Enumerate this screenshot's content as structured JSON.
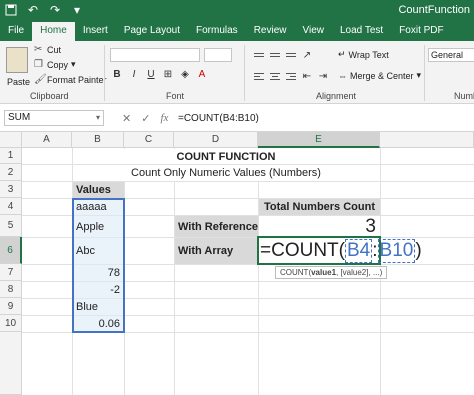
{
  "title_bar": {
    "doc_title": "CountFunction"
  },
  "tabs": [
    "File",
    "Home",
    "Insert",
    "Page Layout",
    "Formulas",
    "Review",
    "View",
    "Load Test",
    "Foxit PDF"
  ],
  "active_tab": "Home",
  "ribbon": {
    "paste": "Paste",
    "cut": "Cut",
    "copy": "Copy",
    "format_painter": "Format Painter",
    "clipboard": "Clipboard",
    "font": "Font",
    "wrap_text": "Wrap Text",
    "merge_center": "Merge & Center",
    "alignment": "Alignment",
    "number_format": "General",
    "number_group": "Numb"
  },
  "formula_bar": {
    "name_box": "SUM",
    "formula": "=COUNT(B4:B10)"
  },
  "columns": [
    "A",
    "B",
    "C",
    "D",
    "E"
  ],
  "rows": [
    "1",
    "2",
    "3",
    "4",
    "5",
    "6",
    "7",
    "8",
    "9",
    "10"
  ],
  "sheet": {
    "title": "COUNT FUNCTION",
    "subtitle": "Count Only Numeric Values (Numbers)",
    "values_header": "Values",
    "values": [
      "aaaaa",
      "Apple",
      "Abc",
      "78",
      "-2",
      "Blue",
      "0.06"
    ],
    "total_header": "Total Numbers Count",
    "with_reference": "With Reference",
    "reference_result": "3",
    "with_array": "With Array",
    "formula_edit": {
      "prefix": "=COUNT(",
      "ref_start": "B4",
      "colon": ":",
      "ref_end": "B10",
      "suffix": ")"
    },
    "tooltip": {
      "fn": "COUNT(",
      "arg1": "value1",
      "rest": ", [value2], ...)"
    }
  },
  "colors": {
    "excel_green": "#217346",
    "selection_blue": "#4472c4",
    "label_gray": "#d9d9d9"
  }
}
